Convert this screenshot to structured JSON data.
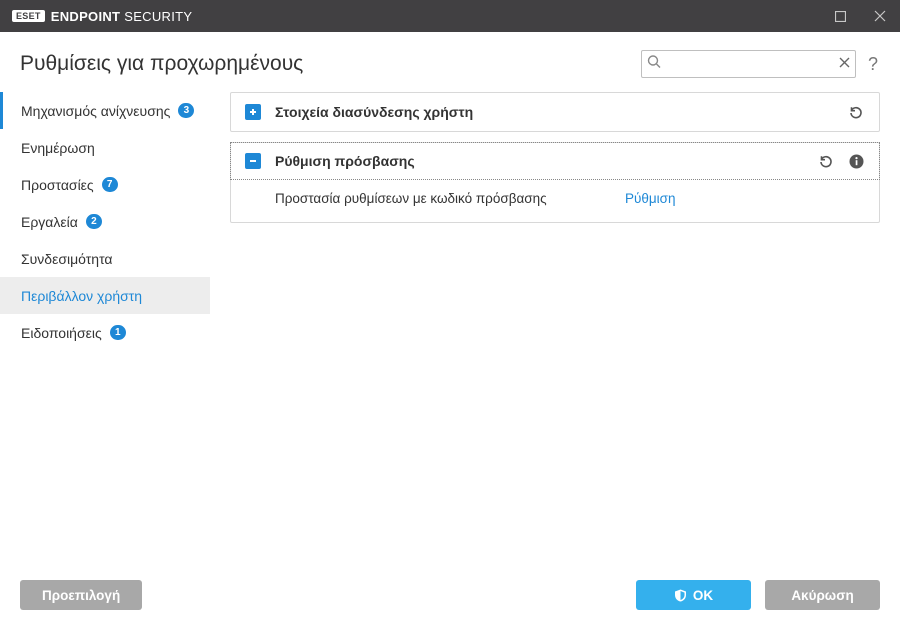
{
  "titlebar": {
    "brand_prefix": "ESET",
    "brand_name_a": "ENDPOINT",
    "brand_name_b": "SECURITY"
  },
  "header": {
    "title": "Ρυθμίσεις για προχωρημένους",
    "search_placeholder": "",
    "help": "?"
  },
  "sidebar": {
    "items": [
      {
        "label": "Μηχανισμός ανίχνευσης",
        "badge": "3",
        "marked": true
      },
      {
        "label": "Ενημέρωση"
      },
      {
        "label": "Προστασίες",
        "badge": "7"
      },
      {
        "label": "Εργαλεία",
        "badge": "2"
      },
      {
        "label": "Συνδεσιμότητα"
      },
      {
        "label": "Περιβάλλον χρήστη",
        "active": true
      },
      {
        "label": "Ειδοποιήσεις",
        "badge": "1"
      }
    ]
  },
  "panels": [
    {
      "expanded": false,
      "title": "Στοιχεία διασύνδεσης χρήστη",
      "has_undo": true,
      "has_info": false
    },
    {
      "expanded": true,
      "title": "Ρύθμιση πρόσβασης",
      "has_undo": true,
      "has_info": true,
      "body_label": "Προστασία ρυθμίσεων με κωδικό πρόσβασης",
      "body_link": "Ρύθμιση"
    }
  ],
  "footer": {
    "default": "Προεπιλογή",
    "ok": "OK",
    "cancel": "Ακύρωση"
  }
}
